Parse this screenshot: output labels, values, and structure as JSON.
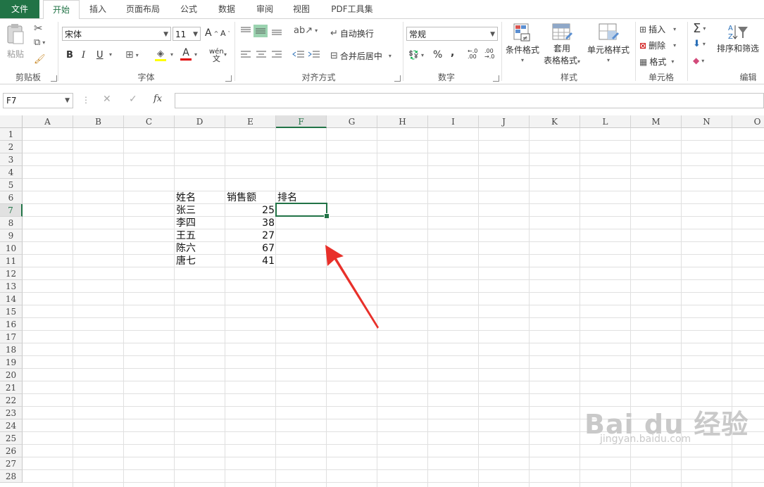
{
  "tabs": [
    {
      "label": "文件"
    },
    {
      "label": "开始"
    },
    {
      "label": "插入"
    },
    {
      "label": "页面布局"
    },
    {
      "label": "公式"
    },
    {
      "label": "数据"
    },
    {
      "label": "审阅"
    },
    {
      "label": "视图"
    },
    {
      "label": "PDF工具集"
    }
  ],
  "ribbon": {
    "clipboard": {
      "paste": "粘贴",
      "group": "剪贴板"
    },
    "font": {
      "name": "宋体",
      "size": "11",
      "group": "字体",
      "bold": "B",
      "italic": "I",
      "underline": "U",
      "grow": "A",
      "shrink": "A",
      "font_color": "A",
      "phonetic": "wén"
    },
    "alignment": {
      "wrap": "自动换行",
      "merge": "合并后居中",
      "group": "对齐方式"
    },
    "number": {
      "format": "常规",
      "group": "数字",
      "percent": "%",
      "comma": ","
    },
    "styles": {
      "conditional": "条件格式",
      "table_line1": "套用",
      "table_line2": "表格格式",
      "cell_styles": "单元格样式",
      "group": "样式"
    },
    "cells": {
      "insert": "插入",
      "delete": "删除",
      "format": "格式",
      "group": "单元格"
    },
    "editing": {
      "sort_filter": "排序和筛选",
      "group": "编辑"
    }
  },
  "formula_bar": {
    "name_box": "F7",
    "fx": "fx",
    "formula": ""
  },
  "sheet": {
    "columns": [
      "A",
      "B",
      "C",
      "D",
      "E",
      "F",
      "G",
      "H",
      "I",
      "J",
      "K",
      "L",
      "M",
      "N",
      "O"
    ],
    "selected_column": "F",
    "rows": [
      "1",
      "2",
      "3",
      "4",
      "5",
      "6",
      "7",
      "8",
      "9",
      "10",
      "11",
      "12",
      "13",
      "14",
      "15",
      "16",
      "17",
      "18",
      "19",
      "20",
      "21",
      "22",
      "23",
      "24",
      "25",
      "26",
      "27",
      "28"
    ],
    "selected_row": "7",
    "headers": {
      "name": "姓名",
      "sales": "销售额",
      "rank": "排名"
    },
    "data": [
      {
        "name": "张三",
        "sales": "25"
      },
      {
        "name": "李四",
        "sales": "38"
      },
      {
        "name": "王五",
        "sales": "27"
      },
      {
        "name": "陈六",
        "sales": "67"
      },
      {
        "name": "唐七",
        "sales": "41"
      }
    ]
  },
  "watermark": {
    "brand": "Bai du 经验",
    "url": "jingyan.baidu.com"
  },
  "colors": {
    "accent": "#217346",
    "arrow": "#e8302a"
  }
}
